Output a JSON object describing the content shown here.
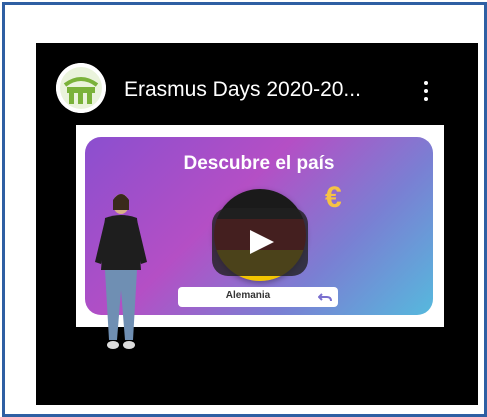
{
  "video": {
    "title": "Erasmus Days 2020-20...",
    "slide_heading": "Descubre el país",
    "answer": "Alemania"
  },
  "icons": {
    "avatar": "channel-logo-icon",
    "menu": "more-vert-icon",
    "play": "play-icon",
    "currency": "euro-icon",
    "undo": "undo-icon"
  },
  "colors": {
    "frame_border": "#2f5fa3",
    "player_bg": "#000000",
    "euro": "#f6c244"
  }
}
